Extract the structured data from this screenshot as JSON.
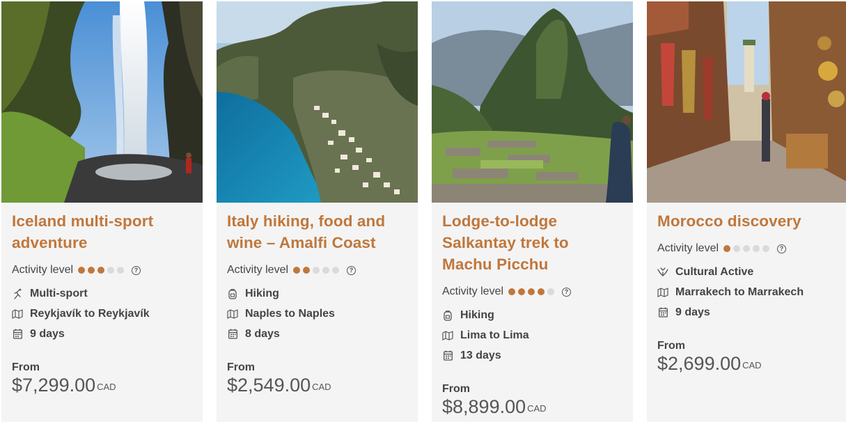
{
  "cards": [
    {
      "title": "Iceland multi-sport adventure",
      "activity_label": "Activity level",
      "activity_level": 3,
      "activity_max": 5,
      "activity_type": "Multi-sport",
      "activity_icon": "multi-sport-icon",
      "route": "Reykjavík to Reykjavík",
      "duration": "9 days",
      "from_label": "From",
      "price": "$7,299.00",
      "currency": "CAD"
    },
    {
      "title": "Italy hiking, food and wine – Amalfi Coast",
      "activity_label": "Activity level",
      "activity_level": 2,
      "activity_max": 5,
      "activity_type": "Hiking",
      "activity_icon": "backpack-icon",
      "route": "Naples to Naples",
      "duration": "8 days",
      "from_label": "From",
      "price": "$2,549.00",
      "currency": "CAD"
    },
    {
      "title": "Lodge-to-lodge Salkantay trek to Machu Picchu",
      "activity_label": "Activity level",
      "activity_level": 4,
      "activity_max": 5,
      "activity_type": "Hiking",
      "activity_icon": "backpack-icon",
      "route": "Lima to Lima",
      "duration": "13 days",
      "from_label": "From",
      "price": "$8,899.00",
      "currency": "CAD"
    },
    {
      "title": "Morocco discovery",
      "activity_label": "Activity level",
      "activity_level": 1,
      "activity_max": 5,
      "activity_type": "Cultural Active",
      "activity_icon": "cultural-hands-icon",
      "route": "Marrakech to Marrakech",
      "duration": "9 days",
      "from_label": "From",
      "price": "$2,699.00",
      "currency": "CAD"
    }
  ],
  "colors": {
    "accent": "#c0773c",
    "card_bg": "#f4f4f4",
    "dot_off": "#dadada",
    "text": "#444444"
  }
}
